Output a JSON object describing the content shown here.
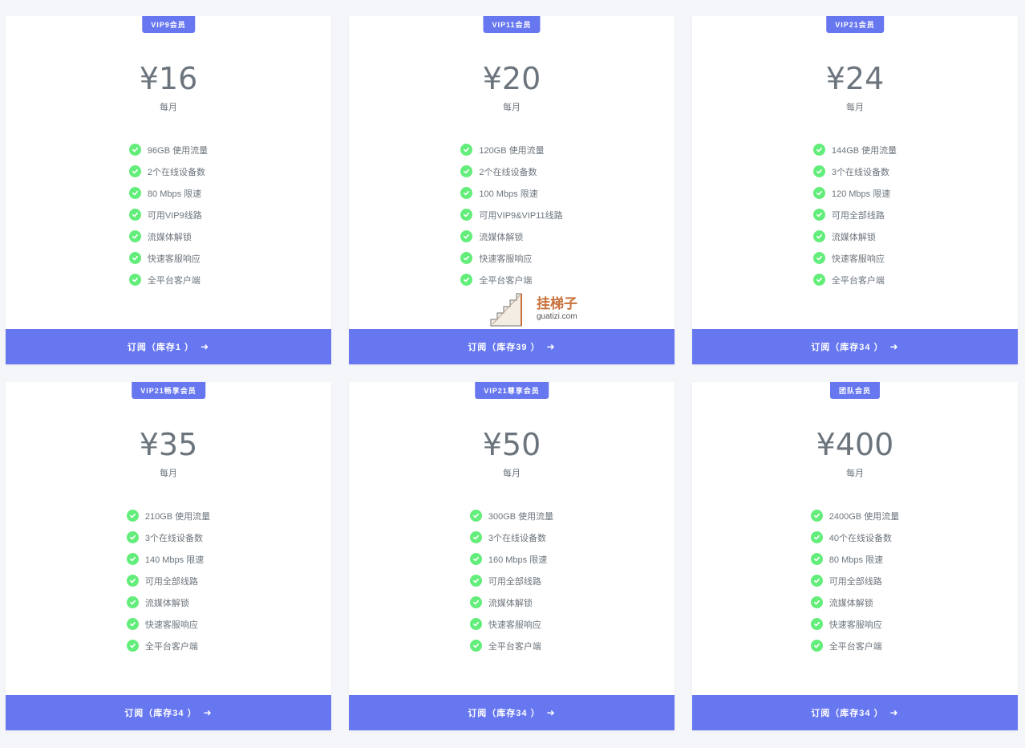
{
  "plans": [
    {
      "badge": "VIP9会员",
      "price": "¥16",
      "period": "每月",
      "features": [
        "96GB 使用流量",
        "2个在线设备数",
        "80 Mbps 限速",
        "可用VIP9线路",
        "流媒体解锁",
        "快速客服响应",
        "全平台客户端"
      ],
      "button": "订阅（库存1 ）",
      "arrow_icon": "arrow-right-icon"
    },
    {
      "badge": "VIP11会员",
      "price": "¥20",
      "period": "每月",
      "features": [
        "120GB 使用流量",
        "2个在线设备数",
        "100 Mbps 限速",
        "可用VIP9&VIP11线路",
        "流媒体解锁",
        "快速客服响应",
        "全平台客户端"
      ],
      "button": "订阅（库存39 ）",
      "arrow_icon": "arrow-right-icon"
    },
    {
      "badge": "VIP21会员",
      "price": "¥24",
      "period": "每月",
      "features": [
        "144GB 使用流量",
        "3个在线设备数",
        "120 Mbps 限速",
        "可用全部线路",
        "流媒体解锁",
        "快速客服响应",
        "全平台客户端"
      ],
      "button": "订阅（库存34 ）",
      "arrow_icon": "arrow-right-icon"
    },
    {
      "badge": "VIP21畅享会员",
      "price": "¥35",
      "period": "每月",
      "features": [
        "210GB 使用流量",
        "3个在线设备数",
        "140 Mbps 限速",
        "可用全部线路",
        "流媒体解锁",
        "快速客服响应",
        "全平台客户端"
      ],
      "button": "订阅（库存34 ）",
      "arrow_icon": "arrow-right-icon"
    },
    {
      "badge": "VIP21尊享会员",
      "price": "¥50",
      "period": "每月",
      "features": [
        "300GB 使用流量",
        "3个在线设备数",
        "160 Mbps 限速",
        "可用全部线路",
        "流媒体解锁",
        "快速客服响应",
        "全平台客户端"
      ],
      "button": "订阅（库存34 ）",
      "arrow_icon": "arrow-right-icon"
    },
    {
      "badge": "团队会员",
      "price": "¥400",
      "period": "每月",
      "features": [
        "2400GB 使用流量",
        "40个在线设备数",
        "80 Mbps 限速",
        "可用全部线路",
        "流媒体解锁",
        "快速客服响应",
        "全平台客户端"
      ],
      "button": "订阅（库存34 ）",
      "arrow_icon": "arrow-right-icon"
    }
  ],
  "watermark": {
    "title": "挂梯子",
    "subtitle": "guatizi.com"
  },
  "colors": {
    "accent": "#6777ef",
    "check": "#63ed7a",
    "text": "#6c757d",
    "background": "#f5f6fa"
  }
}
